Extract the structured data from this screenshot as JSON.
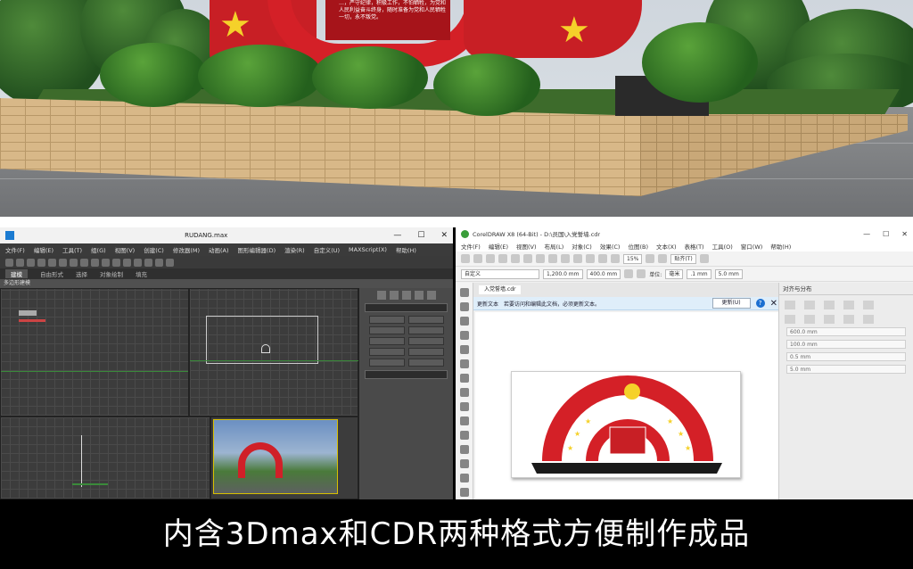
{
  "render": {
    "board_text": "…，严守纪律，积极工作，不怕牺牲，为党和人民利益奋斗终身，随时准备为党和人民牺牲一切，永不叛党。"
  },
  "max": {
    "title": "RUDANG.max",
    "window_controls": [
      "—",
      "☐",
      "✕"
    ],
    "menu": [
      "文件(F)",
      "编辑(E)",
      "工具(T)",
      "组(G)",
      "视图(V)",
      "创建(C)",
      "修改器(M)",
      "动画(A)",
      "图形编辑器(D)",
      "渲染(R)",
      "自定义(U)",
      "MAXScript(X)",
      "帮助(H)"
    ],
    "tabs": [
      "建模",
      "自由形式",
      "选择",
      "对象绘制",
      "填充"
    ],
    "ribbon_label": "多边形建模"
  },
  "cdr": {
    "title": "CorelDRAW X8 (64-Bit) - D:\\员国\\入党誓墙.cdr",
    "window_controls": [
      "—",
      "☐",
      "✕"
    ],
    "menu": [
      "文件(F)",
      "编辑(E)",
      "视图(V)",
      "布局(L)",
      "对象(C)",
      "效果(C)",
      "位图(B)",
      "文本(X)",
      "表格(T)",
      "工具(O)",
      "窗口(W)",
      "帮助(H)"
    ],
    "zoom": "15%",
    "snap_label": "贴齐(T)",
    "page_size_label": "自定义",
    "width": "1,200.0 mm",
    "height": "400.0 mm",
    "unit_label": "单位:",
    "unit": "毫米",
    "nudge": ".1 mm",
    "outline": "0.5 mm",
    "dup_x": "5.0 mm",
    "dup_y": "5.0 mm",
    "doc_tab": "入党誓墙.cdr",
    "alert_title": "更新文本",
    "alert_text": "若要访问和编辑此文档，必须更新文本。",
    "update_button": "更新(U)",
    "docker_title": "对齐与分布",
    "pos_x": "600.0 mm",
    "pos_y": "100.0 mm",
    "tools": [
      "pick",
      "shape",
      "crop",
      "zoom",
      "freehand",
      "smart-fill",
      "rectangle",
      "ellipse",
      "polygon",
      "text",
      "parallel-dim",
      "connector",
      "blend",
      "transparency",
      "eyedropper",
      "fill"
    ]
  },
  "caption": "内含3Dmax和CDR两种格式方便制作成品",
  "colors": {
    "party_red": "#d42027",
    "star_gold": "#f5d12a",
    "max_bg": "#444444",
    "cdr_alert": "#dfeefa"
  }
}
